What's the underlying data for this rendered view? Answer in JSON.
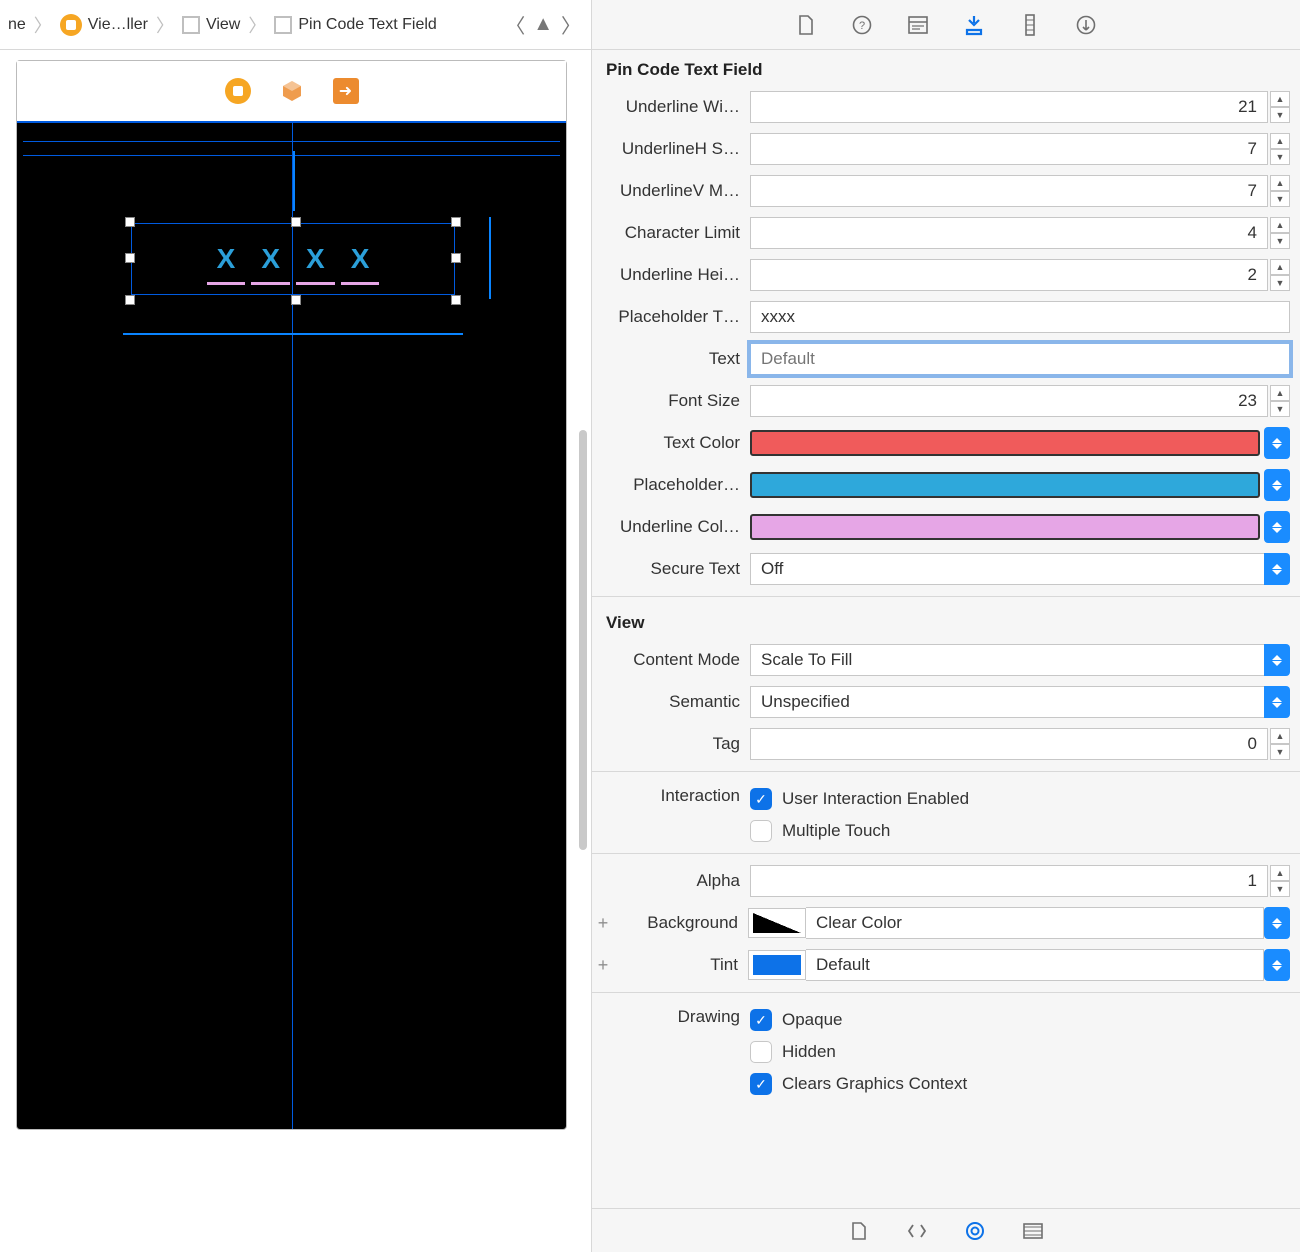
{
  "breadcrumb": {
    "item0": "ne",
    "item1": "Vie…ller",
    "item2": "View",
    "item3": "Pin Code Text Field"
  },
  "canvas": {
    "pin_chars": [
      "X",
      "X",
      "X",
      "X"
    ]
  },
  "inspector": {
    "section1_title": "Pin Code Text Field",
    "underline_wi_label": "Underline Wi…",
    "underline_wi_value": "21",
    "underlineh_s_label": "UnderlineH S…",
    "underlineh_s_value": "7",
    "underlinev_m_label": "UnderlineV M…",
    "underlinev_m_value": "7",
    "char_limit_label": "Character Limit",
    "char_limit_value": "4",
    "underline_hei_label": "Underline Hei…",
    "underline_hei_value": "2",
    "placeholder_t_label": "Placeholder T…",
    "placeholder_t_value": "xxxx",
    "text_label": "Text",
    "text_placeholder": "Default",
    "font_size_label": "Font Size",
    "font_size_value": "23",
    "text_color_label": "Text Color",
    "text_color_hex": "#f05b5b",
    "placeholder_color_label": "Placeholder…",
    "placeholder_color_hex": "#2ea8db",
    "underline_col_label": "Underline Col…",
    "underline_col_hex": "#e6a6e6",
    "secure_text_label": "Secure Text",
    "secure_text_value": "Off",
    "section2_title": "View",
    "content_mode_label": "Content Mode",
    "content_mode_value": "Scale To Fill",
    "semantic_label": "Semantic",
    "semantic_value": "Unspecified",
    "tag_label": "Tag",
    "tag_value": "0",
    "interaction_label": "Interaction",
    "interaction_user_enabled": "User Interaction Enabled",
    "interaction_multiple_touch": "Multiple Touch",
    "alpha_label": "Alpha",
    "alpha_value": "1",
    "background_label": "Background",
    "background_value": "Clear Color",
    "tint_label": "Tint",
    "tint_value": "Default",
    "tint_hex": "#0d72e8",
    "drawing_label": "Drawing",
    "drawing_opaque": "Opaque",
    "drawing_hidden": "Hidden",
    "drawing_clears": "Clears Graphics Context"
  }
}
